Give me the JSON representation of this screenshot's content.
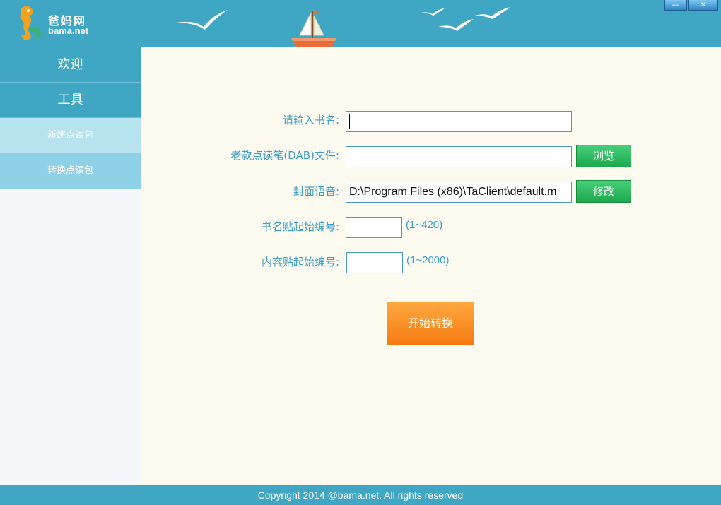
{
  "header": {
    "logo_cn": "爸妈网",
    "logo_en": "bama.net",
    "window_buttons": {
      "minimize": "—",
      "close": "✕"
    }
  },
  "sidebar": {
    "items": [
      {
        "label": "欢迎"
      },
      {
        "label": "工具"
      },
      {
        "label": "新建点读包"
      },
      {
        "label": "转换点读包"
      }
    ]
  },
  "form": {
    "book_name": {
      "label": "请输入书名:",
      "value": ""
    },
    "dab_file": {
      "label": "老款点读笔(DAB)文件:",
      "value": ""
    },
    "cover_audio": {
      "label": "封面语音:",
      "value": "D:\\Program Files (x86)\\TaClient\\default.m"
    },
    "title_start": {
      "label": "书名贴起始编号:",
      "value": "",
      "hint": "(1~420)"
    },
    "content_start": {
      "label": "内容贴起始编号:",
      "value": "",
      "hint": "(1~2000)"
    },
    "browse_button": "浏览",
    "modify_button": "修改",
    "start_button": "开始转换"
  },
  "footer": {
    "copyright": "Copyright  2014 @bama.net. All rights reserved"
  },
  "colors": {
    "header": "#3fa7c4",
    "label": "#3a9ec8",
    "green": "#1ea94e",
    "orange": "#f47b12"
  }
}
